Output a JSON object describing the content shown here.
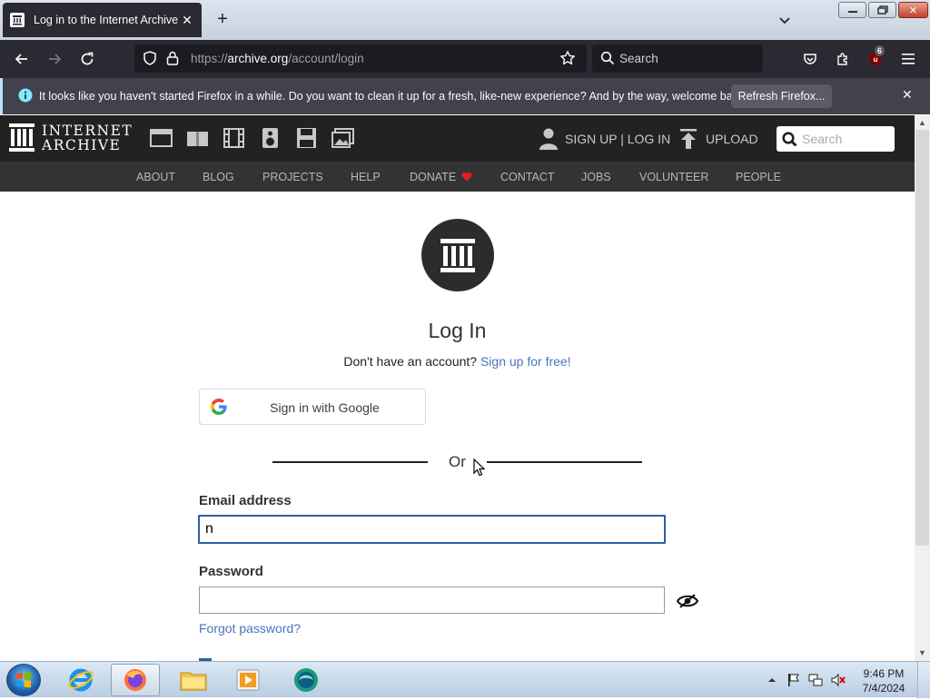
{
  "browser": {
    "tab_title": "Log in to the Internet Archive",
    "url_prefix": "https://",
    "url_host": "archive.org",
    "url_path": "/account/login",
    "search_placeholder": "Search",
    "extension_badge": "6",
    "infobar_message": "It looks like you haven't started Firefox in a while. Do you want to clean it up for a fresh, like-new experience? And by the way, welcome back!",
    "infobar_button": "Refresh Firefox..."
  },
  "ia_header": {
    "logo_line1": "INTERNET",
    "logo_line2": "ARCHIVE",
    "auth_link": "SIGN UP | LOG IN",
    "upload": "UPLOAD",
    "search_placeholder": "Search",
    "nav": [
      "ABOUT",
      "BLOG",
      "PROJECTS",
      "HELP",
      "DONATE",
      "CONTACT",
      "JOBS",
      "VOLUNTEER",
      "PEOPLE"
    ]
  },
  "login": {
    "title": "Log In",
    "no_account": "Don't have an account?",
    "signup_link": "Sign up for free!",
    "google_button": "Sign in with Google",
    "or": "Or",
    "email_label": "Email address",
    "email_value": "n",
    "password_label": "Password",
    "password_value": "",
    "forgot": "Forgot password?"
  },
  "taskbar": {
    "time": "9:46 PM",
    "date": "7/4/2024"
  },
  "colors": {
    "link": "#4b73bf",
    "focus_border": "#2c5ea8",
    "ia_header": "#222222",
    "firefox_dark": "#2b2a33"
  }
}
